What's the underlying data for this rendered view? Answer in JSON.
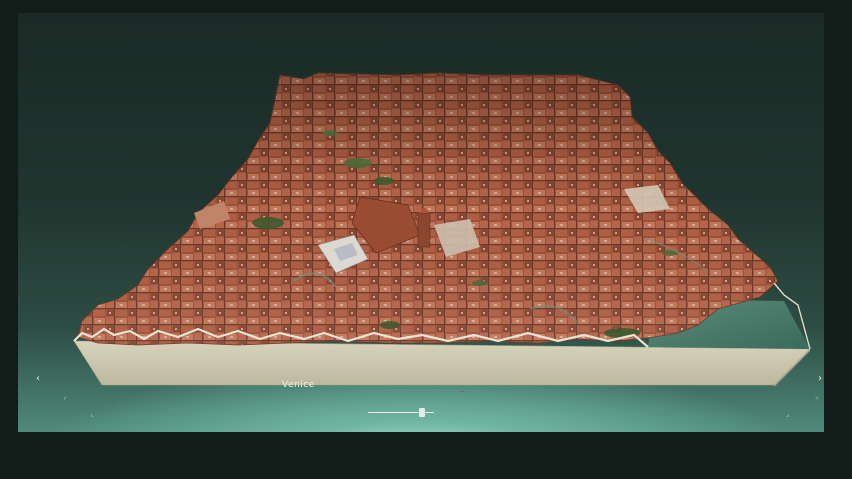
{
  "viewer": {
    "model_title": "Venice",
    "credit": "",
    "slider_caption": "",
    "slider_value": 0.85
  },
  "controls": {
    "prev_icon": "chevron-left-icon",
    "next_icon": "chevron-right-icon",
    "corner_icons": [
      "arrow-top-left-icon",
      "arrow-top-right-icon",
      "arrow-bottom-left-icon",
      "arrow-bottom-right-icon"
    ]
  },
  "colors": {
    "frame_background": "#121d1a",
    "scene_top": "#1b2a26",
    "scene_glow": "#a9e8d6",
    "base_side": "#cfcab2",
    "water": "#47796a",
    "roofs": "#a85a3e"
  }
}
